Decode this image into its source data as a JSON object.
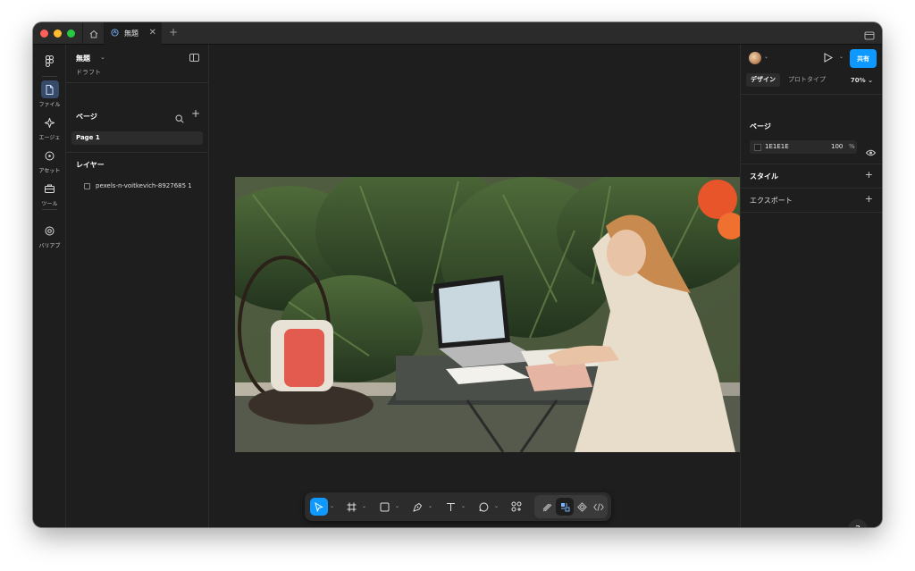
{
  "tab": {
    "title": "無題"
  },
  "rail": {
    "file": "ファイル",
    "agent": "エージェ",
    "asset": "アセット",
    "tool": "ツール",
    "variable": "バリアブ"
  },
  "left": {
    "title": "無題",
    "subtitle": "ドラフト",
    "pages_title": "ページ",
    "page_item": "Page 1",
    "layers_title": "レイヤー",
    "layer_item": "pexels-n-voitkevich-8927685 1"
  },
  "right": {
    "share_label": "共有",
    "tab_design": "デザイン",
    "tab_prototype": "プロトタイプ",
    "zoom": "70%",
    "page_section": "ページ",
    "fill_hex": "1E1E1E",
    "fill_opacity": "100",
    "fill_percent": "%",
    "style_section": "スタイル",
    "export_section": "エクスポート",
    "help": "?"
  },
  "colors": {
    "accent": "#0d99ff",
    "canvas": "#1e1e1e",
    "panel": "#1e1e1e"
  }
}
